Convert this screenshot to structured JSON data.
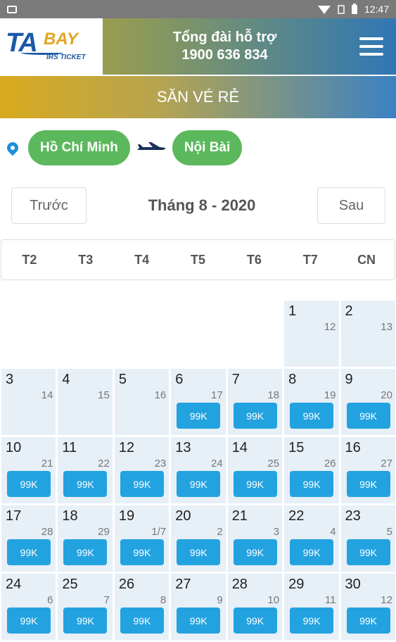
{
  "status_bar": {
    "time": "12:47"
  },
  "header": {
    "logo_ta": "TA",
    "logo_bay": "BAY",
    "logo_sub": "IRS TICKET",
    "hotline_label": "Tổng đài hỗ trợ",
    "hotline_number": "1900 636 834"
  },
  "title": "SĂN VÉ RẺ",
  "route": {
    "from": "Hồ Chí Minh",
    "to": "Nội Bài"
  },
  "month_nav": {
    "prev": "Trước",
    "month": "Tháng 8 - 2020",
    "next": "Sau"
  },
  "weekdays": [
    "T2",
    "T3",
    "T4",
    "T5",
    "T6",
    "T7",
    "CN"
  ],
  "calendar": {
    "leading_empty": 5,
    "days": [
      {
        "day": "1",
        "lunar": "12",
        "price": ""
      },
      {
        "day": "2",
        "lunar": "13",
        "price": ""
      },
      {
        "day": "3",
        "lunar": "14",
        "price": ""
      },
      {
        "day": "4",
        "lunar": "15",
        "price": ""
      },
      {
        "day": "5",
        "lunar": "16",
        "price": ""
      },
      {
        "day": "6",
        "lunar": "17",
        "price": "99K"
      },
      {
        "day": "7",
        "lunar": "18",
        "price": "99K"
      },
      {
        "day": "8",
        "lunar": "19",
        "price": "99K"
      },
      {
        "day": "9",
        "lunar": "20",
        "price": "99K"
      },
      {
        "day": "10",
        "lunar": "21",
        "price": "99K"
      },
      {
        "day": "11",
        "lunar": "22",
        "price": "99K"
      },
      {
        "day": "12",
        "lunar": "23",
        "price": "99K"
      },
      {
        "day": "13",
        "lunar": "24",
        "price": "99K"
      },
      {
        "day": "14",
        "lunar": "25",
        "price": "99K"
      },
      {
        "day": "15",
        "lunar": "26",
        "price": "99K"
      },
      {
        "day": "16",
        "lunar": "27",
        "price": "99K"
      },
      {
        "day": "17",
        "lunar": "28",
        "price": "99K"
      },
      {
        "day": "18",
        "lunar": "29",
        "price": "99K"
      },
      {
        "day": "19",
        "lunar": "1/7",
        "price": "99K"
      },
      {
        "day": "20",
        "lunar": "2",
        "price": "99K"
      },
      {
        "day": "21",
        "lunar": "3",
        "price": "99K"
      },
      {
        "day": "22",
        "lunar": "4",
        "price": "99K"
      },
      {
        "day": "23",
        "lunar": "5",
        "price": "99K"
      },
      {
        "day": "24",
        "lunar": "6",
        "price": "99K"
      },
      {
        "day": "25",
        "lunar": "7",
        "price": "99K"
      },
      {
        "day": "26",
        "lunar": "8",
        "price": "99K"
      },
      {
        "day": "27",
        "lunar": "9",
        "price": "99K"
      },
      {
        "day": "28",
        "lunar": "10",
        "price": "99K"
      },
      {
        "day": "29",
        "lunar": "11",
        "price": "99K"
      },
      {
        "day": "30",
        "lunar": "12",
        "price": "99K"
      }
    ]
  },
  "colors": {
    "accent_blue": "#23a2e0",
    "pill_green": "#5cb85c",
    "cell_bg": "#e7eff7"
  },
  "icons": [
    "image-icon",
    "wifi-icon",
    "no-sim-icon",
    "battery-icon",
    "menu-icon",
    "location-pin-icon",
    "airplane-icon"
  ]
}
